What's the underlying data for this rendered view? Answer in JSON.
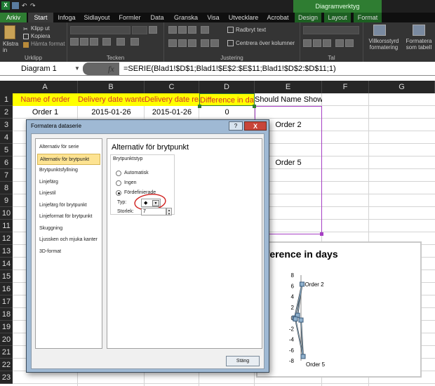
{
  "title_strip": {
    "context_header": "Diagramverktyg"
  },
  "tabs": [
    {
      "label": "Arkiv"
    },
    {
      "label": "Start"
    },
    {
      "label": "Infoga"
    },
    {
      "label": "Sidlayout"
    },
    {
      "label": "Formler"
    },
    {
      "label": "Data"
    },
    {
      "label": "Granska"
    },
    {
      "label": "Visa"
    },
    {
      "label": "Utvecklare"
    },
    {
      "label": "Acrobat"
    },
    {
      "label": "Design"
    },
    {
      "label": "Layout"
    },
    {
      "label": "Format"
    }
  ],
  "ribbon": {
    "paste_label": "Klistra in",
    "cut_label": "Klipp ut",
    "copy_label": "Kopiera",
    "format_painter_label": "Hämta format",
    "group_clipboard": "Urklipp",
    "group_font": "Tecken",
    "group_alignment": "Justering",
    "wrap_text_label": "Radbryt text",
    "merge_label": "Centrera över kolumner",
    "group_number": "Tal",
    "cond_format_label": "Villkorsstyrd formatering",
    "format_table_label": "Formatera som tabell"
  },
  "formula_bar": {
    "name_box": "Diagram 1",
    "fx_label": "fx",
    "formula": "=SERIE(Blad1!$D$1;Blad1!$E$2:$E$11;Blad1!$D$2:$D$11;1)"
  },
  "sheet": {
    "columns": [
      "A",
      "B",
      "C",
      "D",
      "E",
      "F",
      "G"
    ],
    "rows": [
      "1",
      "2",
      "3",
      "4",
      "5",
      "6",
      "7",
      "8",
      "9",
      "10",
      "11",
      "12",
      "13",
      "14",
      "15",
      "16",
      "17",
      "18",
      "19",
      "20",
      "21",
      "22",
      "23"
    ],
    "header_row": {
      "a": "Name of order",
      "b": "Delivery date wanted",
      "c": "Delivery date real",
      "d": "Difference in days",
      "e": "Should Name Show?"
    },
    "row2": {
      "a": "Order 1",
      "b": "2015-01-26",
      "c": "2015-01-26",
      "d": "0"
    },
    "row3_e": "Order 2",
    "row6_e": "Order 5"
  },
  "chart": {
    "title_visible": "fference in days"
  },
  "chart_data": {
    "type": "scatter",
    "title": "fference in days",
    "xlabel": "",
    "ylabel": "",
    "ylim": [
      -8,
      8
    ],
    "y_ticks": [
      "8",
      "6",
      "4",
      "2",
      "0",
      "-2",
      "-4",
      "-6",
      "-8"
    ],
    "series": [
      {
        "points": [
          {
            "x": -0.7,
            "y": 0
          },
          {
            "x": 0.35,
            "y": 6.3,
            "label": "Order 2"
          },
          {
            "x": -0.3,
            "y": 0.5
          },
          {
            "x": 0.2,
            "y": -0.4
          },
          {
            "x": 0.5,
            "y": -7.2,
            "label": "Order 5"
          },
          {
            "x": -0.6,
            "y": -0.2
          }
        ]
      }
    ],
    "grid": false
  },
  "dialog": {
    "title": "Formatera dataserie",
    "help_label": "?",
    "close_label": "X",
    "list": [
      {
        "label": "Alternativ för serie",
        "selected": false
      },
      {
        "label": "Alternativ för brytpunkt",
        "selected": true
      },
      {
        "label": "Brytpunktsfyllning",
        "selected": false
      },
      {
        "label": "Linjefärg",
        "selected": false
      },
      {
        "label": "Linjestil",
        "selected": false
      },
      {
        "label": "Linjefärg för brytpunkt",
        "selected": false
      },
      {
        "label": "Linjeformat för brytpunkt",
        "selected": false
      },
      {
        "label": "Skuggning",
        "selected": false
      },
      {
        "label": "Ljussken och mjuka kanter",
        "selected": false
      },
      {
        "label": "3D-format",
        "selected": false
      }
    ],
    "panel_title": "Alternativ för brytpunkt",
    "group_label": "Brytpunktstyp",
    "radio_auto": "Automatisk",
    "radio_none": "Ingen",
    "radio_builtin": "Fördefinierade",
    "selected_radio": "Fördefinierade",
    "type_label": "Typ:",
    "type_value": "◆",
    "size_label": "Storlek:",
    "size_value": "7",
    "close_button": "Stäng"
  }
}
